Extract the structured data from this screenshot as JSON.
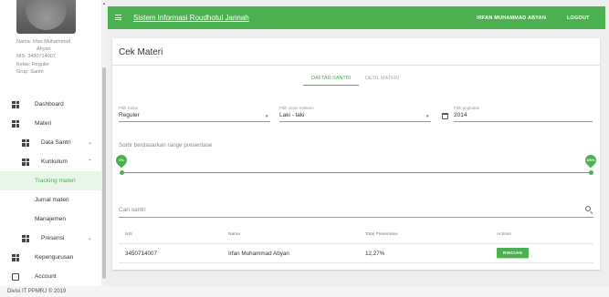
{
  "app": {
    "title": "Sistem Informasi Roudhotul Jannah",
    "user_name": "IRFAN MUHAMMAD ABYAN",
    "logout_label": "LOGOUT",
    "accent_color": "#4caf50"
  },
  "profile": {
    "name_line1": "Nama: Irfan Muhammad",
    "name_line2": "Abyan",
    "nis": "NIS:   3450714007",
    "kelas": "Kelas: Reguler",
    "grup": "Grup:  Santri"
  },
  "sidebar": {
    "items": [
      {
        "label": "Dashboard",
        "icon": "grid-icon"
      },
      {
        "label": "Materi",
        "icon": "grid-icon"
      },
      {
        "label": "Data Santri",
        "icon": "grid-icon",
        "chevron": "⌄"
      },
      {
        "label": "Kurikulum",
        "icon": "grid-icon",
        "chevron": "⌃"
      },
      {
        "label": "Tracking materi"
      },
      {
        "label": "Jurnal materi"
      },
      {
        "label": "Manajemen"
      },
      {
        "label": "Presensi",
        "icon": "grid-icon",
        "chevron": "⌄"
      },
      {
        "label": "Kepengurusan",
        "icon": "grid-icon"
      },
      {
        "label": "Account",
        "icon": "account-icon"
      }
    ]
  },
  "footer": {
    "text": "Divisi IT PPMRJ © 2019"
  },
  "page": {
    "title": "Cek Materi",
    "tabs": [
      {
        "label": "DAFTAR SANTRI",
        "active": true
      },
      {
        "label": "DETIL MATERI",
        "active": false
      }
    ]
  },
  "filters": {
    "kelas": {
      "label": "Pilih Kelas",
      "value": "Reguler"
    },
    "gender": {
      "label": "Pilih Jenis Kelamin",
      "value": "Laki - laki"
    },
    "angkatan": {
      "label": "Pilih angkatan",
      "value": "2014"
    }
  },
  "slider": {
    "label": "Sortir berdasarkan range presentase",
    "min_label": "0%",
    "max_label": "100%",
    "min_value": 0,
    "max_value": 100
  },
  "search": {
    "placeholder": "Cari santri"
  },
  "table": {
    "headers": [
      "NIS",
      "Nama",
      "Total Presentase",
      "Actions"
    ],
    "rows": [
      {
        "nis": "3450714007",
        "nama": "Irfan Muhammad Abyan",
        "total": "12,27%",
        "action": "RINCIAN"
      }
    ]
  }
}
